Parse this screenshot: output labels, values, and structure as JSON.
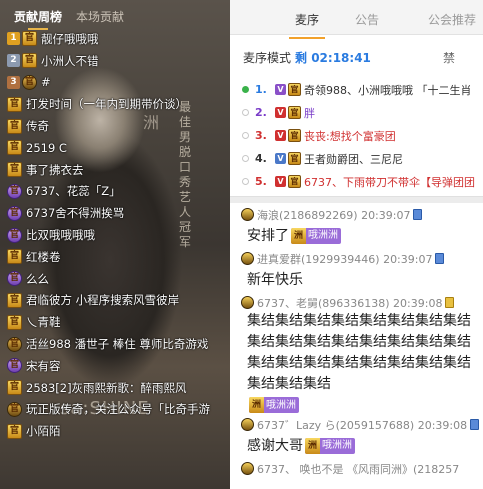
{
  "left_tabs": {
    "weekly": "贡献周榜",
    "session": "本场贡献"
  },
  "poster": {
    "vertical_text_1": "最佳男脱口秀艺人冠军",
    "vertical_text_2": "洲",
    "shine": "sa:SHINE"
  },
  "contributors": [
    {
      "rank": "1",
      "badge": "gold",
      "name": "靓仔哦哦哦"
    },
    {
      "rank": "2",
      "badge": "gold",
      "name": "小洲人不错"
    },
    {
      "rank": "3",
      "badge": "dark",
      "name": "#"
    },
    {
      "rank": "",
      "badge": "gold",
      "name": "打发时间（一年内到期带价谈）"
    },
    {
      "rank": "",
      "badge": "gold",
      "name": "传奇"
    },
    {
      "rank": "",
      "badge": "gold",
      "name": "2519 C"
    },
    {
      "rank": "",
      "badge": "gold",
      "name": "事了拂衣去"
    },
    {
      "rank": "",
      "badge": "purple",
      "name": "6737、花蕊「Z」"
    },
    {
      "rank": "",
      "badge": "purple",
      "name": "6737舍不得洲挨骂"
    },
    {
      "rank": "",
      "badge": "purple",
      "name": "比双哦哦哦哦"
    },
    {
      "rank": "",
      "badge": "gold",
      "name": "红楼卷"
    },
    {
      "rank": "",
      "badge": "purple",
      "name": "么么"
    },
    {
      "rank": "",
      "badge": "gold",
      "name": "君临彼方 小程序搜索风雪彼岸"
    },
    {
      "rank": "",
      "badge": "gold",
      "name": "乀青鞋"
    },
    {
      "rank": "",
      "badge": "dark",
      "name": "活丝988 潘世子 棒住 尊师比奇游戏"
    },
    {
      "rank": "",
      "badge": "purple",
      "name": "宋有容"
    },
    {
      "rank": "",
      "badge": "gold",
      "name": "2583[2]灰雨熙新歌：醉雨熙风"
    },
    {
      "rank": "",
      "badge": "dark",
      "name": "玩正版传奇，关注公众号「比奇手游"
    },
    {
      "rank": "",
      "badge": "gold",
      "name": "小陌陌"
    }
  ],
  "right_tabs": {
    "queue": "麦序",
    "notice": "公告",
    "recommend": "公会推荐"
  },
  "queue_header": {
    "mode": "麦序模式",
    "remaining": "剩 02:18:41",
    "ban": "禁"
  },
  "queue": [
    {
      "num": "1.",
      "active": true,
      "icons": [
        "pur",
        "gold"
      ],
      "text": "奇领988、小洲哦哦哦 「十二生肖",
      "style": "c1"
    },
    {
      "num": "2.",
      "active": false,
      "icons": [
        "vip",
        "gold"
      ],
      "text": "胖",
      "style": "c2"
    },
    {
      "num": "3.",
      "active": false,
      "icons": [
        "vip",
        "gold"
      ],
      "text": "丧丧:想找个富豪团",
      "style": "c3"
    },
    {
      "num": "4.",
      "active": false,
      "icons": [
        "blue",
        "gold"
      ],
      "text": "王者勋爵团、三尼尼",
      "style": "c4"
    },
    {
      "num": "5.",
      "active": false,
      "icons": [
        "vip",
        "gold"
      ],
      "text": "6737、下雨带刀不带伞【导弹团团",
      "style": "c5"
    }
  ],
  "chat": [
    {
      "user": "海浪(2186892269) 20:39:07",
      "dev": "blue",
      "message": "安排了",
      "fan_badge": "哦洲洲",
      "type": "short"
    },
    {
      "user": "进真爱群(1929939446) 20:39:07",
      "dev": "blue",
      "message": "新年快乐",
      "fan_badge": "",
      "type": "short"
    },
    {
      "user": "6737、老舅(896336138) 20:39:08",
      "dev": "yellow",
      "message": "集结集结集结集结集结集结集结集结集结集结集结集结集结集结集结集结集结集结集结集结集结集结集结集结集结集结集结",
      "fan_badge": "哦洲洲",
      "type": "block"
    },
    {
      "user": "6737゛Lazy ら(2059157688) 20:39:08",
      "dev": "blue",
      "message": "感谢大哥",
      "fan_badge": "哦洲洲",
      "type": "short"
    },
    {
      "user": "6737、 唤也不是 《风雨同洲》(218257",
      "dev": "",
      "message": "",
      "fan_badge": "",
      "type": "short"
    }
  ]
}
